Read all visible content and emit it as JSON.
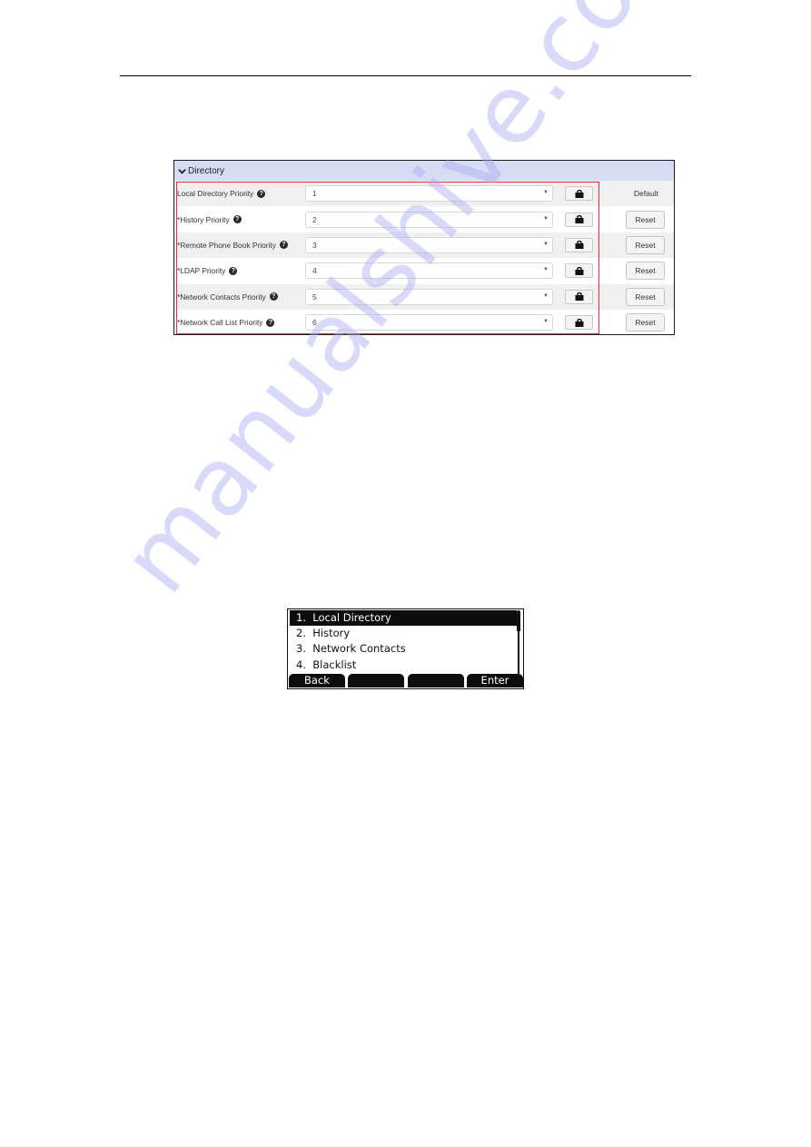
{
  "web_config": {
    "section_title": "Directory",
    "default_column_label": "Default",
    "rows": [
      {
        "label": "Local Directory Priority",
        "value": "1",
        "has_reset": false
      },
      {
        "label": "*History Priority",
        "value": "2",
        "has_reset": true
      },
      {
        "label": "*Remote Phone Book Priority",
        "value": "3",
        "has_reset": true
      },
      {
        "label": "*LDAP Priority",
        "value": "4",
        "has_reset": true
      },
      {
        "label": "*Network Contacts Priority",
        "value": "5",
        "has_reset": true
      },
      {
        "label": "*Network Call List Priority",
        "value": "6",
        "has_reset": true
      }
    ],
    "reset_label": "Reset",
    "help_glyph": "?",
    "lock_icon": "lock-icon",
    "highlight_color": "#e53037",
    "header_color": "#d6dcf3"
  },
  "phone_lcd": {
    "items": [
      {
        "label": "1.  Local Directory",
        "selected": true
      },
      {
        "label": "2.  History",
        "selected": false
      },
      {
        "label": "3.  Network Contacts",
        "selected": false
      },
      {
        "label": "4.  Blacklist",
        "selected": false
      }
    ],
    "softkeys": [
      "Back",
      "",
      "",
      "Enter"
    ]
  },
  "watermark": "manualshive.com"
}
